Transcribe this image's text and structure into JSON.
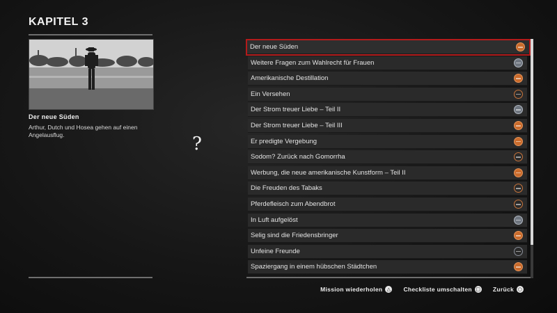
{
  "chapter": {
    "title": "KAPITEL 3"
  },
  "selected_mission": {
    "name": "Der neue Süden",
    "description": "Arthur, Dutch und Hosea gehen auf einen Angelausflug."
  },
  "cursor_glyph": "?",
  "missions": [
    {
      "label": "Der neue Süden",
      "medal": "gold",
      "selected": true
    },
    {
      "label": "Weitere Fragen zum Wahlrecht für Frauen",
      "medal": "silver"
    },
    {
      "label": "Amerikanische Destillation",
      "medal": "gold"
    },
    {
      "label": "Ein Versehen",
      "medal": "bronze"
    },
    {
      "label": "Der Strom treuer Liebe – Teil II",
      "medal": "silver"
    },
    {
      "label": "Der Strom treuer Liebe – Teil III",
      "medal": "gold"
    },
    {
      "label": "Er predigte Vergebung",
      "medal": "gold"
    },
    {
      "label": "Sodom? Zurück nach Gomorrha",
      "medal": "bronze"
    },
    {
      "label": "Werbung, die neue amerikanische Kunstform – Teil II",
      "medal": "gold"
    },
    {
      "label": "Die Freuden des Tabaks",
      "medal": "bronze"
    },
    {
      "label": "Pferdefleisch zum Abendbrot",
      "medal": "bronze"
    },
    {
      "label": "In Luft aufgelöst",
      "medal": "silver"
    },
    {
      "label": "Selig sind die Friedensbringer",
      "medal": "gold"
    },
    {
      "label": "Unfeine Freunde",
      "medal": "none"
    },
    {
      "label": "Spaziergang in einem hübschen Städtchen",
      "medal": "gold"
    }
  ],
  "prompts": [
    {
      "label": "Mission wiederholen",
      "glyph": "△"
    },
    {
      "label": "Checkliste umschalten",
      "glyph": "□"
    },
    {
      "label": "Zurück",
      "glyph": "○"
    }
  ],
  "colors": {
    "selection_outline": "#b31b1b",
    "gold_medal": "#c96b2c",
    "silver_medal": "#6f7680",
    "bronze_medal": "#c8743b"
  }
}
